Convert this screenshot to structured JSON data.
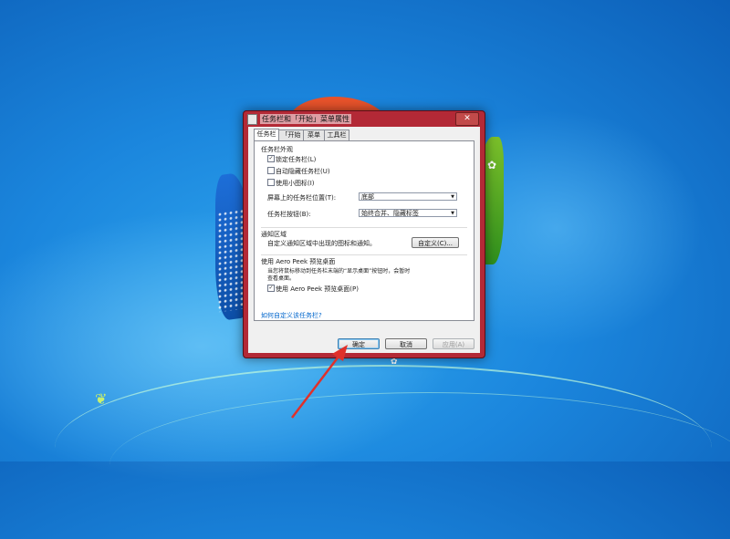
{
  "dialog": {
    "title": "任务栏和「开始」菜单属性",
    "close_label": "✕",
    "tabs": [
      "任务栏",
      "「开始」菜单",
      "工具栏"
    ],
    "tabs_short": [
      "任务栏",
      "「开始",
      "菜单",
      "工具栏"
    ],
    "section_appearance": "任务栏外观",
    "lock_taskbar": "锁定任务栏(L)",
    "autohide": "自动隐藏任务栏(U)",
    "small_icons": "使用小图标(I)",
    "location_label": "屏幕上的任务栏位置(T):",
    "location_value": "底部",
    "buttons_label": "任务栏按钮(B):",
    "buttons_value": "始终合并、隐藏标签",
    "notify_section": "通知区域",
    "notify_text": "自定义通知区域中出现的图标和通知。",
    "customize_button": "自定义(C)...",
    "peek_section": "使用 Aero Peek 预览桌面",
    "peek_text_1": "当您将鼠标移动到任务栏末端的“显示桌面”按钮时，会暂时",
    "peek_text_2": "查看桌面。",
    "peek_checkbox": "使用 Aero Peek 预览桌面(P)",
    "help_link": "如何自定义该任务栏?",
    "ok": "确定",
    "cancel": "取消",
    "apply": "应用(A)",
    "check_mark": "✓"
  },
  "colors": {
    "title_bar": "#b32936",
    "arrow": "#e0302a",
    "desktop": "#1b86dd"
  }
}
